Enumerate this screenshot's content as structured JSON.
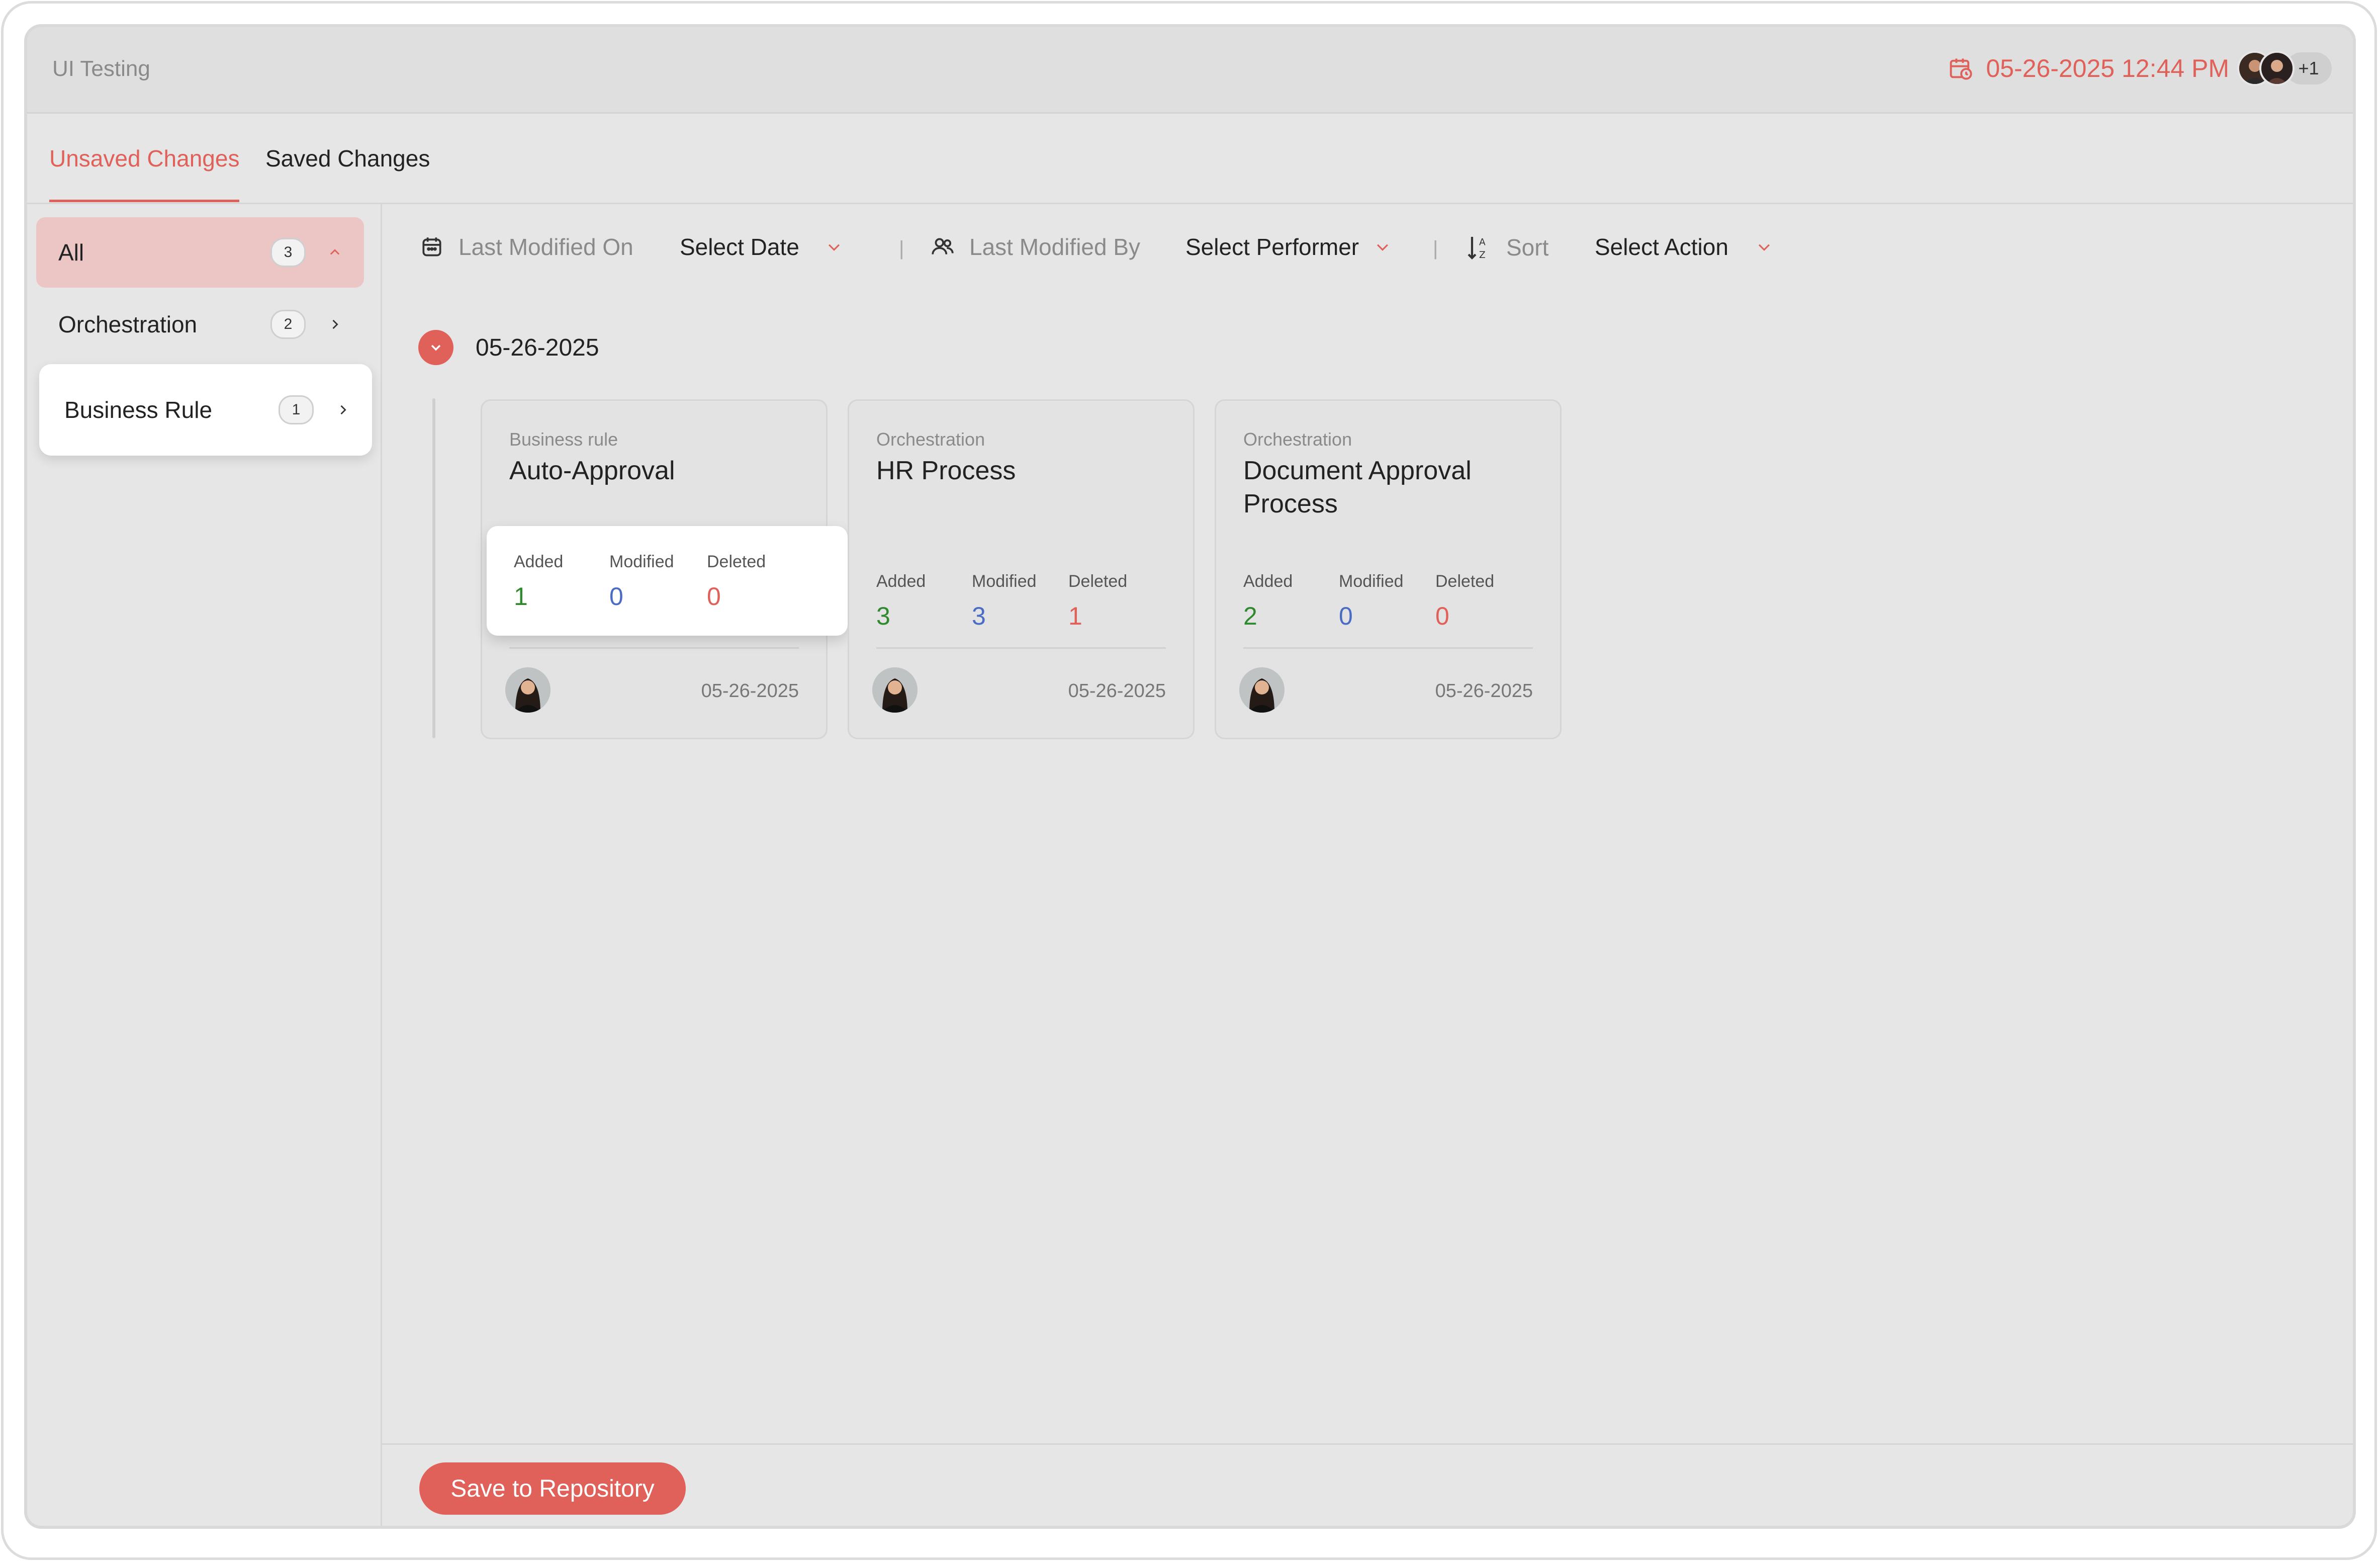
{
  "app": {
    "title": "UI Testing"
  },
  "header": {
    "timestamp": "05-26-2025 12:44 PM",
    "extra_users": "+1"
  },
  "tabs": [
    {
      "label": "Unsaved Changes",
      "active": true
    },
    {
      "label": "Saved Changes",
      "active": false
    }
  ],
  "sidebar": {
    "items": [
      {
        "label": "All",
        "count": "3",
        "expanded": true
      },
      {
        "label": "Orchestration",
        "count": "2"
      },
      {
        "label": "Business Rule",
        "count": "1"
      }
    ]
  },
  "filters": {
    "modified_on_label": "Last Modified On",
    "date_value": "Select Date",
    "modified_by_label": "Last Modified By",
    "performer_value": "Select Performer",
    "sort_label": "Sort",
    "action_value": "Select Action"
  },
  "group": {
    "date": "05-26-2025"
  },
  "cards": [
    {
      "category": "Business rule",
      "title": "Auto-Approval",
      "added": "1",
      "modified": "0",
      "deleted": "0",
      "date": "05-26-2025"
    },
    {
      "category": "Orchestration",
      "title": "HR Process",
      "added": "3",
      "modified": "3",
      "deleted": "1",
      "date": "05-26-2025"
    },
    {
      "category": "Orchestration",
      "title": "Document Approval Process",
      "added": "2",
      "modified": "0",
      "deleted": "0",
      "date": "05-26-2025"
    }
  ],
  "stat_labels": {
    "added": "Added",
    "modified": "Modified",
    "deleted": "Deleted"
  },
  "footer": {
    "save_label": "Save to Repository"
  },
  "colors": {
    "accent": "#e0615a",
    "added": "#2f8a2f",
    "modified": "#4a6cc4",
    "deleted": "#e0615a"
  },
  "icons": [
    "calendar-icon",
    "users-icon",
    "sort-az-icon",
    "chevron-down-icon",
    "chevron-up-icon",
    "chevron-right-icon"
  ]
}
